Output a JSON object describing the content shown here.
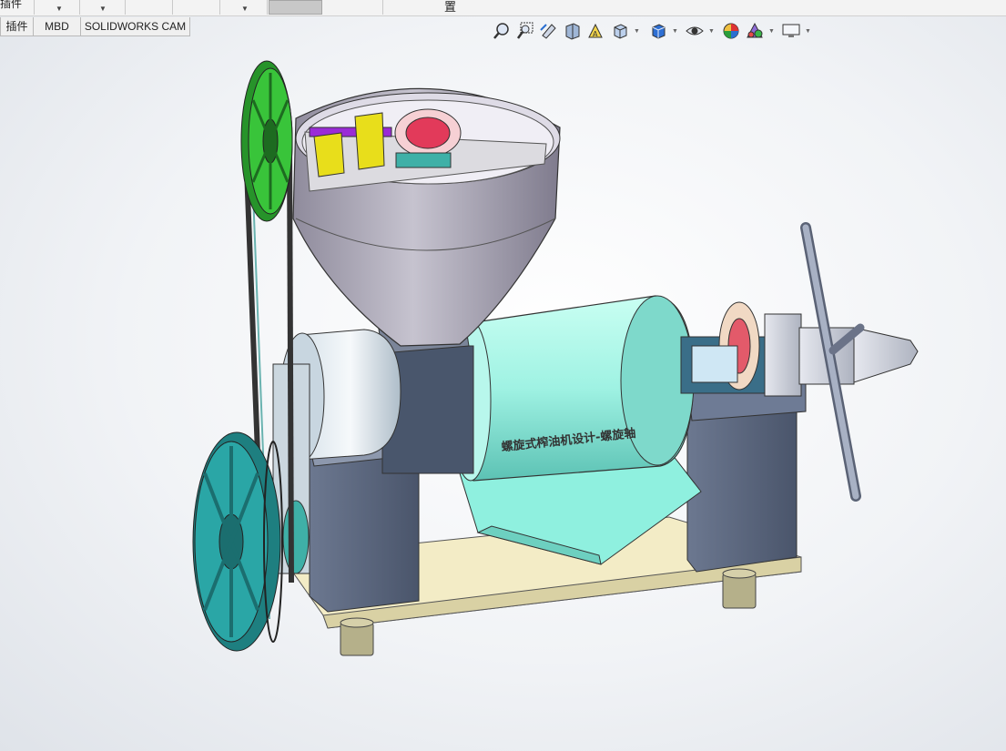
{
  "app": {
    "toolbar": {
      "left_label": "插件",
      "right_label": "置"
    },
    "tabs": [
      {
        "label": "插件"
      },
      {
        "label": "MBD"
      },
      {
        "label": "SOLIDWORKS CAM"
      }
    ],
    "heads_up_toolbar": [
      {
        "icon": "zoom-to-fit-icon"
      },
      {
        "icon": "zoom-to-area-icon"
      },
      {
        "icon": "previous-view-icon"
      },
      {
        "icon": "section-view-icon"
      },
      {
        "icon": "dynamic-annotation-icon"
      },
      {
        "icon": "view-orientation-icon"
      },
      {
        "icon": "display-style-icon"
      },
      {
        "icon": "hide-show-items-icon"
      },
      {
        "icon": "edit-appearance-icon"
      },
      {
        "icon": "apply-scene-icon"
      },
      {
        "icon": "view-settings-icon"
      }
    ]
  },
  "model": {
    "engraved_text": "螺旋式榨油机设计-螺旋轴",
    "colors": {
      "pulley_green": "#39c43a",
      "pulley_teal": "#2aa6a6",
      "gearbox_blue": "#57637a",
      "barrel_mint": "#9ff2e3",
      "hopper_gray": "#a7a3b2",
      "base_tan": "#f3ecc6",
      "shaft_purple": "#9a2bd6",
      "bearing_yellow": "#e8de1b",
      "gear_red": "#e23a5a"
    }
  }
}
